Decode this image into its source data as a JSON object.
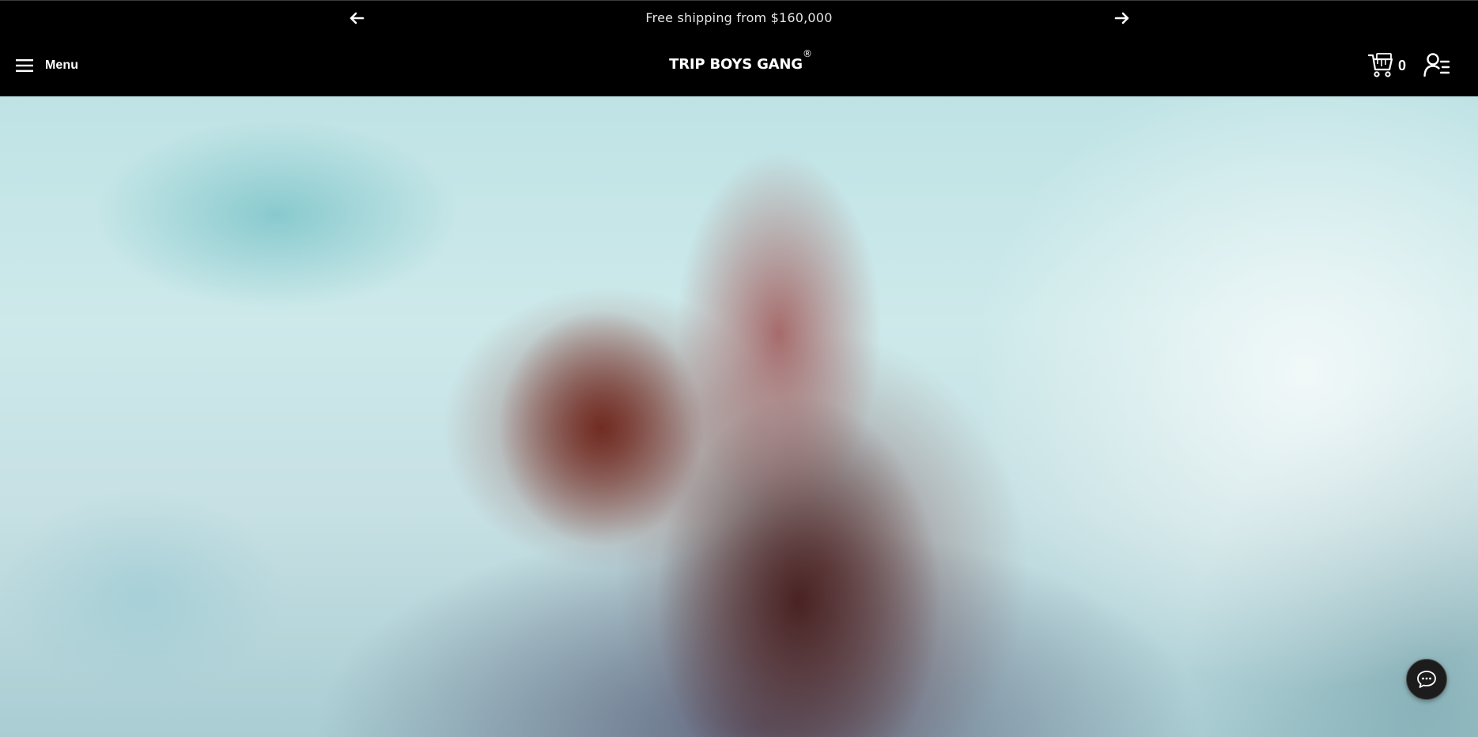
{
  "announcement": {
    "text": "Free shipping from $160,000",
    "prev_icon": "arrow-left-icon",
    "next_icon": "arrow-right-icon"
  },
  "header": {
    "menu_label": "Menu",
    "menu_icon": "hamburger-icon",
    "logo_text": "TRIP BOYS GANG",
    "logo_mark": "®",
    "cart_icon": "cart-icon",
    "cart_count": "0",
    "account_icon": "account-list-icon"
  },
  "hero": {
    "image": "blurred-hero-image"
  },
  "chat": {
    "icon": "chat-bubble-icon"
  },
  "colors": {
    "header_bg": "#000000",
    "header_text": "#ffffff",
    "announcement_text": "#e6e6e6",
    "chat_button_bg": "#1c1c1c"
  }
}
